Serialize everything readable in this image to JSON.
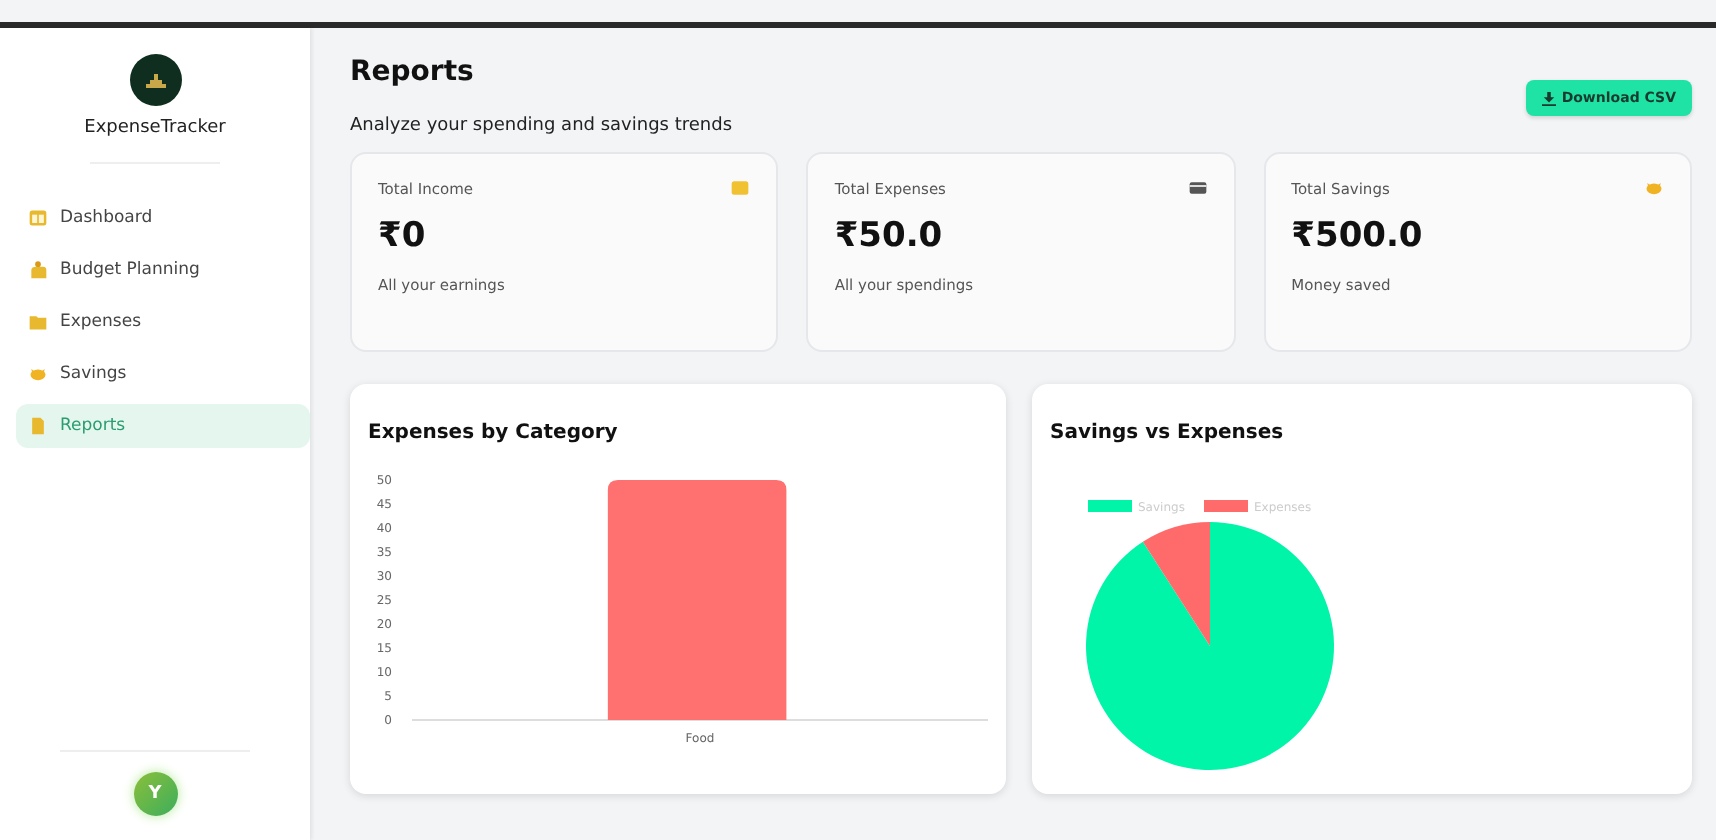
{
  "sidebar": {
    "app_name": "ExpenseTracker",
    "items": [
      {
        "label": "Dashboard",
        "selected": false
      },
      {
        "label": "Budget Planning",
        "selected": false
      },
      {
        "label": "Expenses",
        "selected": false
      },
      {
        "label": "Savings",
        "selected": false
      },
      {
        "label": "Reports",
        "selected": true
      }
    ],
    "avatar_initial": "Y"
  },
  "header": {
    "title": "Reports",
    "subtitle": "Analyze your spending and savings trends",
    "button": "Download CSV"
  },
  "cards": [
    {
      "label": "Total Income",
      "value": "₹0",
      "caption": "All your earnings"
    },
    {
      "label": "Total Expenses",
      "value": "₹50.0",
      "caption": "All your spendings"
    },
    {
      "label": "Total Savings",
      "value": "₹500.0",
      "caption": "Money saved"
    }
  ],
  "charts": [
    {
      "title": "Expenses by Category",
      "chart_data": {
        "type": "bar",
        "categories": [
          "Food"
        ],
        "series": [
          {
            "color": "#ff7070",
            "values": [
              50
            ]
          }
        ],
        "ylim": [
          0,
          50
        ],
        "yticks": [
          0,
          5,
          10,
          15,
          20,
          25,
          30,
          35,
          40,
          45,
          50
        ]
      }
    },
    {
      "title": "Savings vs Expenses",
      "chart_data": {
        "type": "pie",
        "categories": [
          "Savings",
          "Expenses"
        ],
        "values": [
          90.9,
          9.1
        ],
        "colors": [
          "#00f5a8",
          "#ff6b6b"
        ],
        "legend": "top"
      }
    }
  ]
}
